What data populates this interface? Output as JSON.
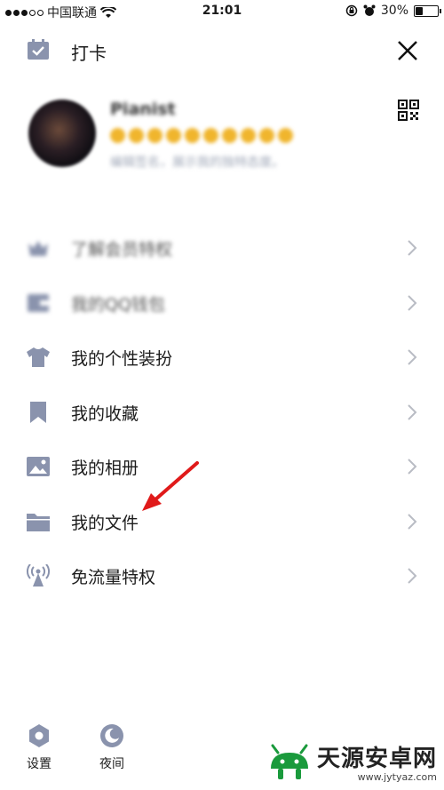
{
  "status_bar": {
    "carrier": "中国联通",
    "time": "21:01",
    "battery": "30%",
    "battery_level": 0.3
  },
  "header": {
    "title": "打卡"
  },
  "profile": {
    "nickname": "Pianist",
    "signature": "编辑签名，展示我的独特态度。"
  },
  "menu": {
    "items": [
      {
        "label": "了解会员特权",
        "icon": "vip-icon",
        "blurred": true
      },
      {
        "label": "我的QQ钱包",
        "icon": "wallet-icon",
        "blurred": true
      },
      {
        "label": "我的个性装扮",
        "icon": "shirt-icon",
        "blurred": false
      },
      {
        "label": "我的收藏",
        "icon": "bookmark-icon",
        "blurred": false
      },
      {
        "label": "我的相册",
        "icon": "photo-icon",
        "blurred": false
      },
      {
        "label": "我的文件",
        "icon": "folder-icon",
        "blurred": false
      },
      {
        "label": "免流量特权",
        "icon": "signal-tower-icon",
        "blurred": false
      }
    ]
  },
  "bottom": {
    "settings_label": "设置",
    "night_label": "夜间"
  },
  "watermark": {
    "title": "天源安卓网",
    "url": "www.jytyaz.com"
  },
  "colors": {
    "icon": "#8a93ad",
    "annotation_arrow": "#e01a1a",
    "watermark_green": "#1a9a3c"
  }
}
